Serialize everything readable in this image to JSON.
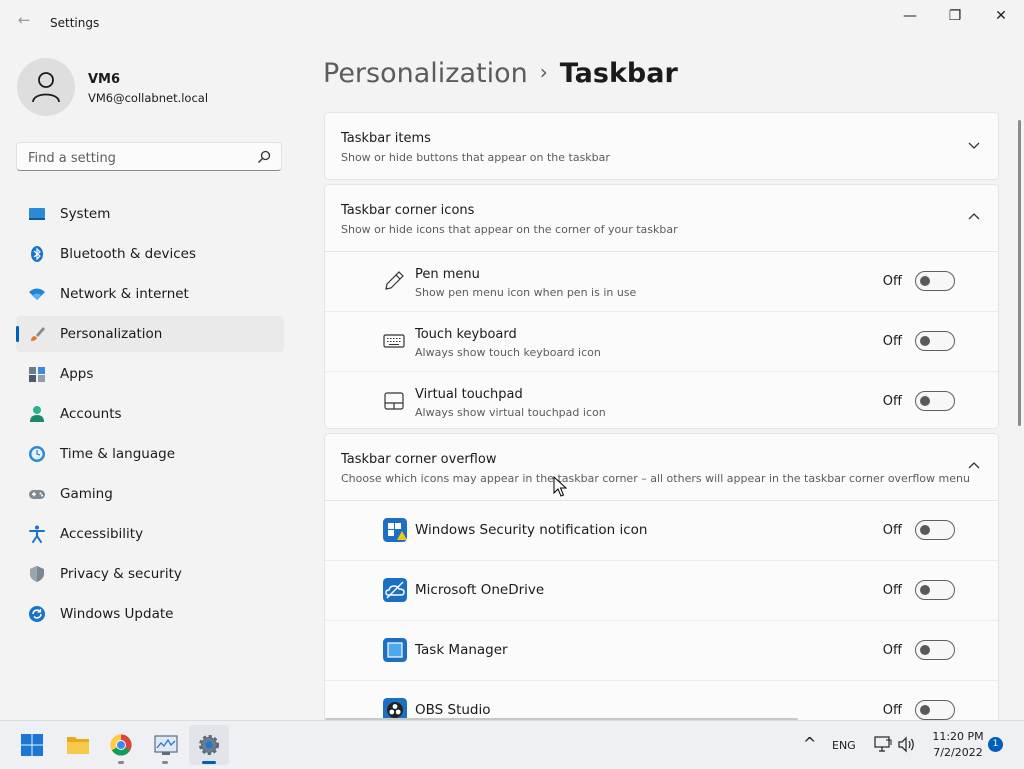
{
  "window": {
    "title": "Settings",
    "back_icon": "back-arrow-icon",
    "minimize_glyph": "—",
    "maximize_glyph": "❐",
    "close_glyph": "✕"
  },
  "user": {
    "name": "VM6",
    "email": "VM6@collabnet.local"
  },
  "search": {
    "placeholder": "Find a setting"
  },
  "nav": {
    "items": [
      {
        "label": "System",
        "icon": "system-icon"
      },
      {
        "label": "Bluetooth & devices",
        "icon": "bluetooth-icon"
      },
      {
        "label": "Network & internet",
        "icon": "wifi-icon"
      },
      {
        "label": "Personalization",
        "icon": "brush-icon",
        "active": true
      },
      {
        "label": "Apps",
        "icon": "apps-icon"
      },
      {
        "label": "Accounts",
        "icon": "accounts-icon"
      },
      {
        "label": "Time & language",
        "icon": "time-language-icon"
      },
      {
        "label": "Gaming",
        "icon": "gaming-icon"
      },
      {
        "label": "Accessibility",
        "icon": "accessibility-icon"
      },
      {
        "label": "Privacy & security",
        "icon": "shield-icon"
      },
      {
        "label": "Windows Update",
        "icon": "update-icon"
      }
    ]
  },
  "breadcrumb": {
    "parent": "Personalization",
    "separator": "›",
    "current": "Taskbar"
  },
  "sections": {
    "taskbar_items": {
      "title": "Taskbar items",
      "description": "Show or hide buttons that appear on the taskbar"
    },
    "corner_icons": {
      "title": "Taskbar corner icons",
      "description": "Show or hide icons that appear on the corner of your taskbar",
      "rows": [
        {
          "title": "Pen menu",
          "description": "Show pen menu icon when pen is in use",
          "state": "Off",
          "icon": "pen-icon"
        },
        {
          "title": "Touch keyboard",
          "description": "Always show touch keyboard icon",
          "state": "Off",
          "icon": "keyboard-icon"
        },
        {
          "title": "Virtual touchpad",
          "description": "Always show virtual touchpad icon",
          "state": "Off",
          "icon": "touchpad-icon"
        }
      ]
    },
    "corner_overflow": {
      "title": "Taskbar corner overflow",
      "description": "Choose which icons may appear in the taskbar corner – all others will appear in the taskbar corner overflow menu",
      "rows": [
        {
          "title": "Windows Security notification icon",
          "state": "Off",
          "icon": "windows-security-icon"
        },
        {
          "title": "Microsoft OneDrive",
          "state": "Off",
          "icon": "onedrive-icon"
        },
        {
          "title": "Task Manager",
          "state": "Off",
          "icon": "task-manager-icon"
        },
        {
          "title": "OBS Studio",
          "state": "Off",
          "icon": "obs-studio-icon"
        }
      ]
    }
  },
  "taskbar": {
    "apps": [
      "start-icon",
      "file-explorer-icon",
      "chrome-icon",
      "performance-monitor-icon",
      "settings-icon"
    ],
    "tray": {
      "chevron": "^",
      "language": "ENG",
      "time": "11:20 PM",
      "date": "7/2/2022",
      "notification_count": "1"
    }
  },
  "colors": {
    "accent": "#005fb8",
    "background": "#f3f3f3",
    "card": "#fbfbfb"
  }
}
